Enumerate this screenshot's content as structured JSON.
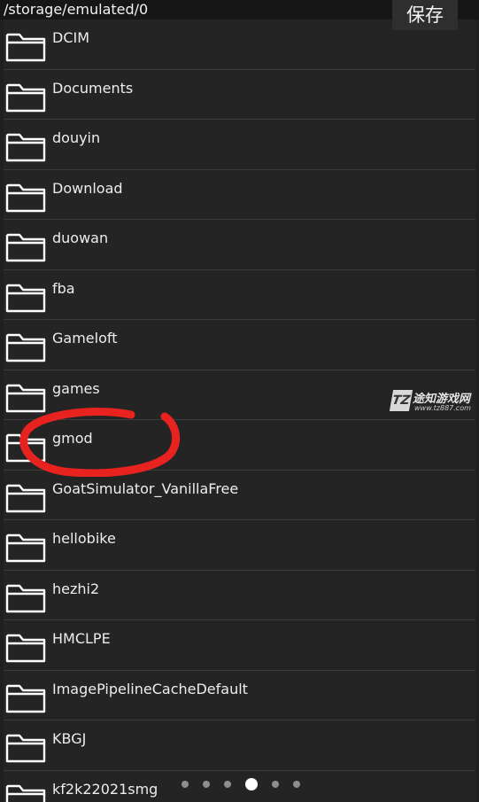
{
  "header": {
    "path": "/storage/emulated/0",
    "save_label": "保存"
  },
  "folders": [
    {
      "name": "DCIM"
    },
    {
      "name": "Documents"
    },
    {
      "name": "douyin"
    },
    {
      "name": "Download"
    },
    {
      "name": "duowan"
    },
    {
      "name": "fba"
    },
    {
      "name": "Gameloft"
    },
    {
      "name": "games"
    },
    {
      "name": "gmod"
    },
    {
      "name": "GoatSimulator_VanillaFree"
    },
    {
      "name": "hellobike"
    },
    {
      "name": "hezhi2"
    },
    {
      "name": "HMCLPE"
    },
    {
      "name": "ImagePipelineCacheDefault"
    },
    {
      "name": "KBGJ"
    },
    {
      "name": "kf2k22021smg"
    }
  ],
  "pager": {
    "count": 6,
    "active_index": 3
  },
  "watermark": {
    "logo": "TZ",
    "title": "途知游戏网",
    "url": "www.tz887.com"
  },
  "annotation": {
    "highlight_color": "#e8231f",
    "highlighted_item": "gmod"
  },
  "colors": {
    "background": "#1f1f1f",
    "row_background": "#242424",
    "separator": "#3a3a3a",
    "text": "#ededed"
  }
}
